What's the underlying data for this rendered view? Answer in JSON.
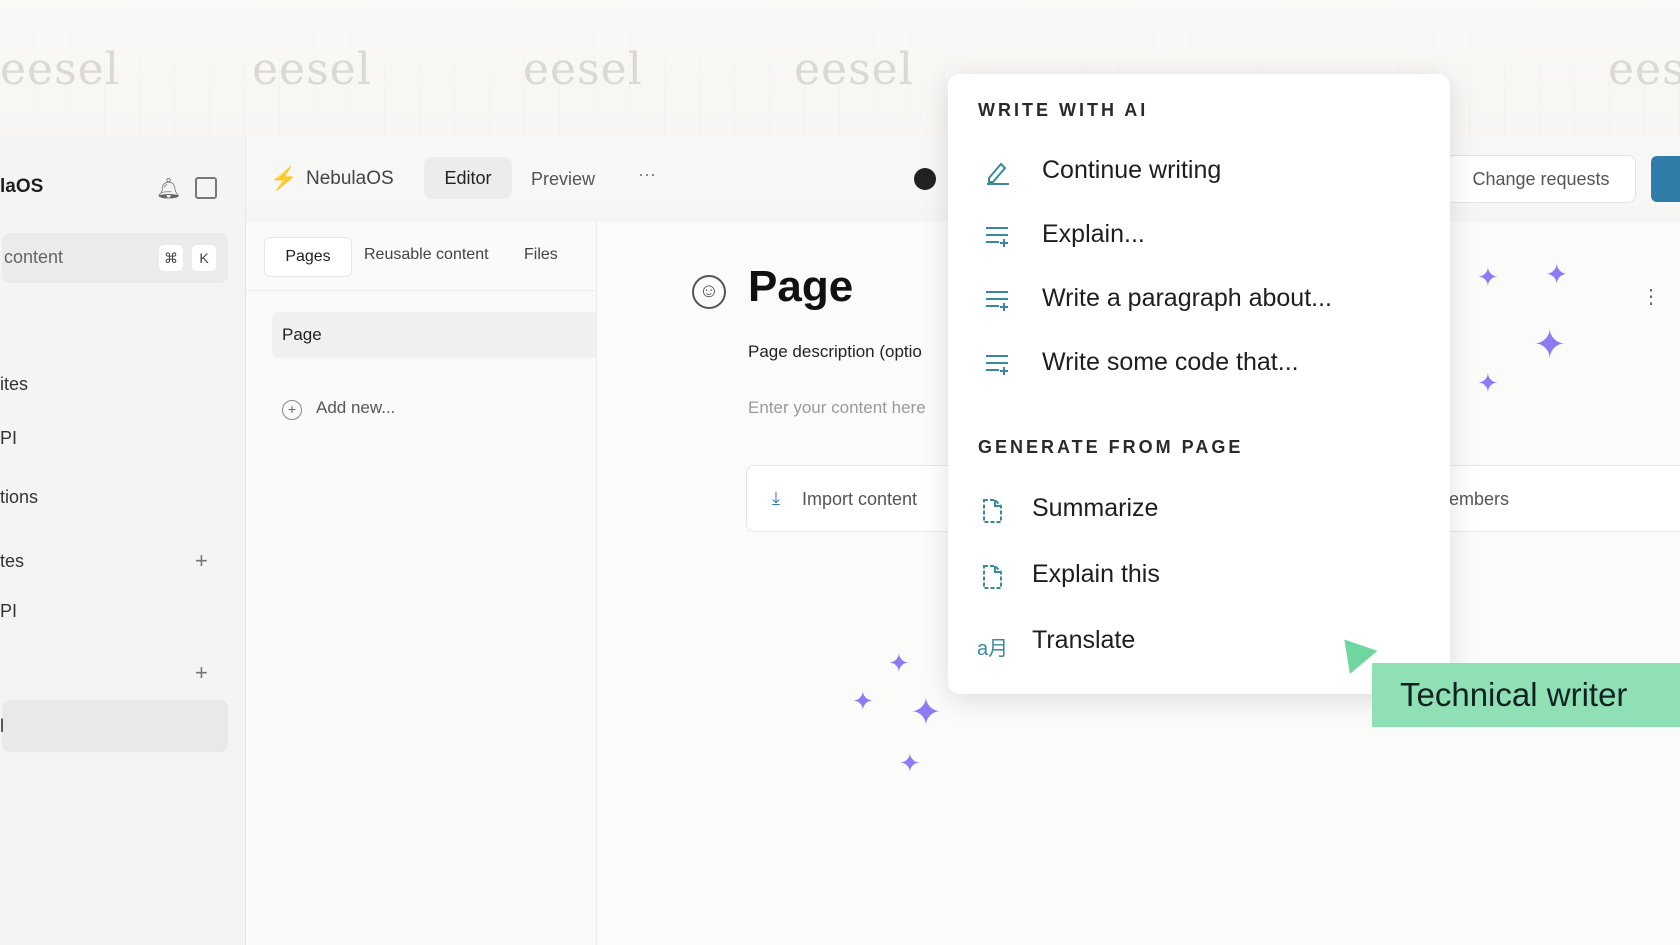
{
  "watermark": {
    "text": "eesel"
  },
  "sidebar": {
    "title": "laOS",
    "search_label": "content",
    "kbd_cmd": "⌘",
    "kbd_k": "K",
    "items": [
      "ites",
      "PI",
      "tions",
      "tes",
      "PI",
      "l"
    ]
  },
  "topbar": {
    "brand": "NebulaOS",
    "tab_editor": "Editor",
    "tab_preview": "Preview",
    "more": "···",
    "change_requests": "Change requests"
  },
  "pages_panel": {
    "tabs": [
      "Pages",
      "Reusable content",
      "Files"
    ],
    "page_item": "Page",
    "add_new": "Add new..."
  },
  "editor": {
    "title": "Page",
    "description": "Page description (optio",
    "placeholder": "Enter your content here",
    "import_label": "Import content",
    "members": "embers"
  },
  "popup": {
    "section1": "WRITE WITH AI",
    "write_items": [
      "Continue writing",
      "Explain...",
      "Write a paragraph about...",
      "Write some code that..."
    ],
    "section2": "GENERATE FROM PAGE",
    "generate_items": [
      "Summarize",
      "Explain this",
      "Translate"
    ]
  },
  "badge": {
    "label": "Technical writer",
    "color": "#8fe0b4"
  },
  "colors": {
    "accent": "#2f7da8",
    "sparkle": "#8b7cf6",
    "icon": "#3a8a99"
  }
}
